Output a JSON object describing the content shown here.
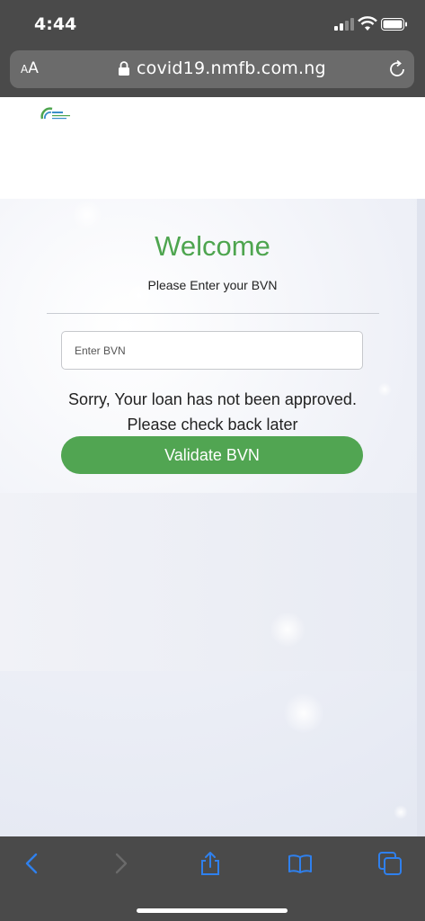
{
  "status_bar": {
    "time": "4:44"
  },
  "browser": {
    "aa_label_small": "A",
    "aa_label_large": "A",
    "url": "covid19.nmfb.com.ng"
  },
  "form": {
    "title": "Welcome",
    "subtitle": "Please Enter your BVN",
    "bvn_placeholder": "Enter BVN",
    "message_line1": "Sorry, Your loan has not been approved.",
    "message_line2": "Please check back later",
    "validate_label": "Validate BVN"
  },
  "colors": {
    "accent_green": "#51a552",
    "toolbar": "#4a4a4a",
    "toolbar_icon": "#2f80ed"
  }
}
